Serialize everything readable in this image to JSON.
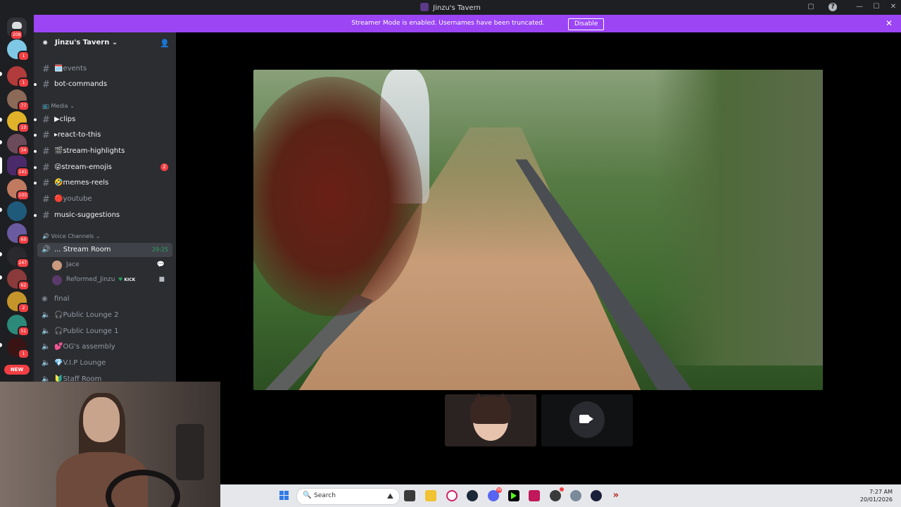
{
  "window": {
    "title": "Jinzu's Tavern"
  },
  "banner": {
    "text": "Streamer Mode is enabled. Usernames have been truncated.",
    "disable_label": "Disable"
  },
  "servers": {
    "home_badge": "208",
    "badges": [
      "1",
      "1",
      "77",
      "10",
      "34",
      "141",
      "103",
      "",
      "60",
      "247",
      "62",
      "2",
      "51",
      "1"
    ],
    "new_label": "NEW"
  },
  "sidebar": {
    "server_name": "Jinzu's Tavern",
    "channels": [
      {
        "label": "🗓️events",
        "muted": true
      },
      {
        "label": "bot-commands",
        "muted": false
      },
      {
        "label": "▶clips",
        "muted": false
      },
      {
        "label": "▸react-to-this",
        "muted": false
      },
      {
        "label": "🎬stream-highlights",
        "muted": false
      },
      {
        "label": "😜stream-emojis",
        "muted": false,
        "count": "2"
      },
      {
        "label": "🤣memes-reels",
        "muted": false
      },
      {
        "label": "🔴youtube",
        "muted": true
      },
      {
        "label": "music-suggestions",
        "muted": false
      }
    ],
    "media_category": "📺 Media",
    "voice_category": "🔊 Voice Channels",
    "stream_room": {
      "label": "... Stream Room",
      "timer": "29:25"
    },
    "members": [
      {
        "name": "Jace"
      },
      {
        "name": "Reformed_Jinzu",
        "tag": "KICK"
      }
    ],
    "voice_channels": [
      {
        "label": "final"
      },
      {
        "label": "🎧Public Lounge 2"
      },
      {
        "label": "🎧Public Lounge 1"
      },
      {
        "label": "💕OG's assembly"
      },
      {
        "label": "💎V.I.P Lounge"
      },
      {
        "label": "🔰Staff Room"
      }
    ]
  },
  "taskbar": {
    "search_placeholder": "Search",
    "time": "7:27 AM",
    "date": "20/01/2026",
    "discord_badge": "99"
  },
  "colors": {
    "banner": "#9b45f5",
    "unread": "#f23f43",
    "voice_active": "#23a55a"
  }
}
